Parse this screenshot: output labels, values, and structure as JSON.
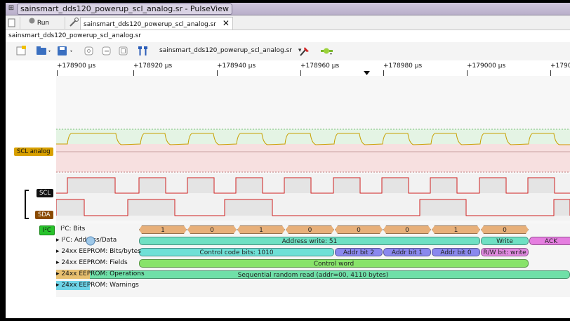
{
  "window": {
    "title": "sainsmart_dds120_powerup_scl_analog.sr - PulseView"
  },
  "tabs": [
    {
      "label": "Run"
    },
    {
      "label": "sainsmart_dds120_powerup_scl_analog.sr"
    }
  ],
  "file_label": "sainsmart_dds120_powerup_scl_analog.sr",
  "toolbar": {
    "session_label": "sainsmart_dds120_powerup_scl_analog.sr"
  },
  "ruler": {
    "ticks": [
      "+178900 µs",
      "+178920 µs",
      "+178940 µs",
      "+178960 µs",
      "+178980 µs",
      "+179000 µs",
      "+1790"
    ]
  },
  "channels": {
    "scl_analog": "SCL analog",
    "scl": "SCL",
    "sda": "SDA"
  },
  "decoder_rows": [
    {
      "label": "I²C: Bits"
    },
    {
      "label": "I²C: Address/Data"
    },
    {
      "label": "24xx EEPROM: Bits/bytes"
    },
    {
      "label": "24xx EEPROM: Fields"
    },
    {
      "label": "24xx EEPROM: Operations"
    },
    {
      "label": "24xx EEPROM: Warnings"
    }
  ],
  "decoder_tag": "I²C",
  "annotations": {
    "bits": [
      "1",
      "0",
      "1",
      "0",
      "0",
      "0",
      "1",
      "0"
    ],
    "address": [
      "Address write: 51",
      "Write",
      "ACK"
    ],
    "bits_bytes": [
      "Control code bits: 1010",
      "Addr bit 2",
      "Addr bit 1",
      "Addr bit 0",
      "R/W bit: write"
    ],
    "fields": [
      "Control word"
    ],
    "operations": [
      "Sequential random read (addr=00, 4110 bytes)"
    ]
  },
  "colors": {
    "scl_analog_badge": "#d8a000",
    "scl_badge": "#111111",
    "sda_badge": "#8a4a00",
    "i2c_tag": "#27c22b",
    "bit_fill": "#e8b07a",
    "address_fill": "#6fe0c3",
    "write_fill": "#6fe0c3",
    "ack_fill": "#e57ee0",
    "control_fill": "#6fe0d6",
    "addrbit_fill": "#8a88ee",
    "rw_fill": "#e08ae0",
    "fields_fill": "#88e36a",
    "ops_fill": "#6fe0a8",
    "high_green": "#2aa02a",
    "low_red": "#d02020"
  }
}
